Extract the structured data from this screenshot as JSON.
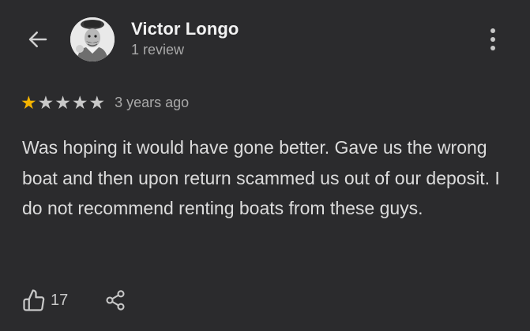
{
  "header": {
    "back_icon": "arrow-left-icon",
    "reviewer_name": "Victor Longo",
    "reviewer_subtitle": "1 review",
    "menu_icon": "more-vertical-icon"
  },
  "review": {
    "rating": 1,
    "max_rating": 5,
    "star_color": "#f5b400",
    "time_ago": "3 years ago",
    "text": "Was hoping it would have gone better. Gave us the wrong boat and then upon return scammed us out of our deposit. I do not recommend renting boats from these guys."
  },
  "actions": {
    "like_icon": "thumbs-up-icon",
    "like_count": "17",
    "share_icon": "share-icon"
  }
}
